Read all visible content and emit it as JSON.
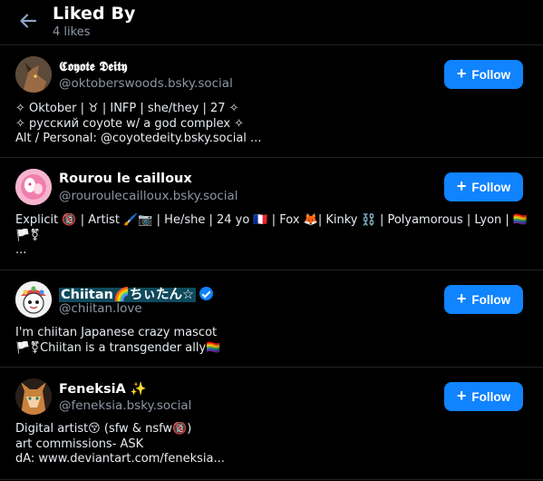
{
  "header": {
    "title": "Liked By",
    "count": "4 likes"
  },
  "colors": {
    "background": "#000000",
    "accent": "#1083fe",
    "muted": "#8c97a6",
    "divider": "#1f242b"
  },
  "follow_label": "Follow",
  "users": [
    {
      "display_name": "𝕮𝖔𝖞𝖔𝖙𝖊 𝕯𝖊𝖎𝖙𝖞",
      "handle": "@oktoberswoods.bsky.social",
      "bio": [
        "✧ Oktober | ♉ | INFP | she/they | 27 ✧",
        "✧ русский coyote w/ a god complex ✧",
        "Alt / Personal: @coyotedeity.bsky.social ..."
      ]
    },
    {
      "display_name": "Rourou le cailloux",
      "handle": "@rouroulecailloux.bsky.social",
      "bio": [
        "Explicit 🔞 | Artist 🖌️📷 | He/she | 24 yo 🇫🇷 | Fox 🦊| Kinky ⛓️ | Polyamorous | Lyon | 🏳️‍🌈",
        "🏳️⚧",
        "..."
      ]
    },
    {
      "display_name": "Chiitan🌈ちぃたん☆",
      "handle": "@chiitan.love",
      "bio": [
        "I'm chiitan Japanese crazy mascot",
        "🏳️⚧Chiitan is a transgender ally🏳️‍🌈"
      ]
    },
    {
      "display_name": "FeneksiA ✨",
      "handle": "@feneksia.bsky.social",
      "bio": [
        "Digital artist😚 (sfw & nsfw🔞)",
        "art commissions- ASK",
        "dA: www.deviantart.com/feneksia..."
      ]
    }
  ]
}
